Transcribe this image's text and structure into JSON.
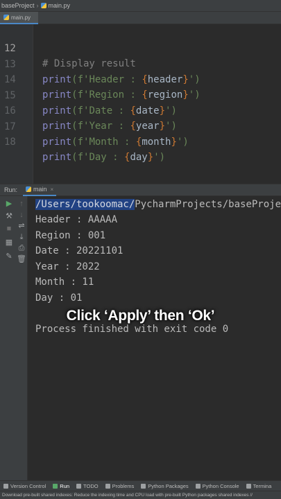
{
  "breadcrumb": {
    "project": "baseProject",
    "file": "main.py"
  },
  "tab": {
    "label": "main.py"
  },
  "editor": {
    "lines": [
      {
        "num": "12",
        "comment": "# Display result"
      },
      {
        "num": "13",
        "fn": "print",
        "pre": "(f'Header : ",
        "var": "header",
        "post": "')"
      },
      {
        "num": "14",
        "fn": "print",
        "pre": "(f'Region : ",
        "var": "region",
        "post": "')"
      },
      {
        "num": "15",
        "fn": "print",
        "pre": "(f'Date : ",
        "var": "date",
        "post": "')"
      },
      {
        "num": "16",
        "fn": "print",
        "pre": "(f'Year : ",
        "var": "year",
        "post": "')"
      },
      {
        "num": "17",
        "fn": "print",
        "pre": "(f'Month : ",
        "var": "month",
        "post": "')"
      },
      {
        "num": "18",
        "fn": "print",
        "pre": "(f'Day : ",
        "var": "day",
        "post": "')"
      }
    ]
  },
  "run": {
    "label": "Run:",
    "tab": "main"
  },
  "console": {
    "path_highlight": "/Users/tookoomac/",
    "path_rest": "PycharmProjects/baseProjec",
    "lines": [
      "Header : AAAAA",
      "Region : 001",
      "Date : 20221101",
      "Year : 2022",
      "Month : 11",
      "Day : 01"
    ],
    "exit": "Process finished with exit code 0"
  },
  "caption": "Click ‘Apply’ then ‘Ok’",
  "toolwindows": [
    "Version Control",
    "Run",
    "TODO",
    "Problems",
    "Python Packages",
    "Python Console",
    "Termina"
  ],
  "status": "Download pre-built shared indexes: Reduce the indexing time and CPU load with pre-built Python packages shared indexes //"
}
